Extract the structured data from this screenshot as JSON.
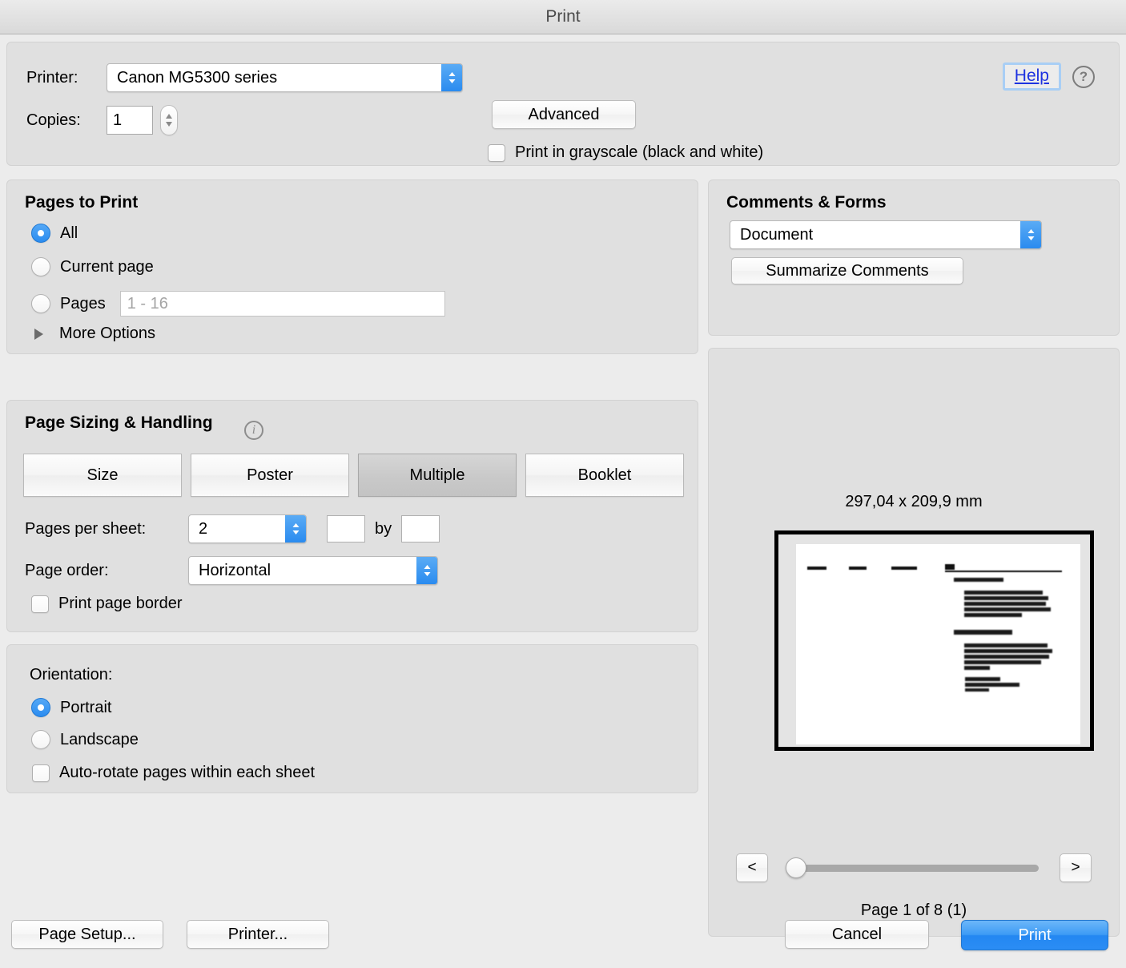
{
  "window": {
    "title": "Print"
  },
  "printer_section": {
    "printer_label": "Printer:",
    "printer_value": "Canon MG5300 series",
    "advanced_label": "Advanced",
    "copies_label": "Copies:",
    "copies_value": "1",
    "grayscale_label": "Print in grayscale (black and white)",
    "grayscale_checked": false,
    "help_label": "Help",
    "help_icon": "question-mark-icon"
  },
  "pages_to_print": {
    "title": "Pages to Print",
    "options": [
      {
        "label": "All",
        "selected": true
      },
      {
        "label": "Current page",
        "selected": false
      },
      {
        "label": "Pages",
        "selected": false
      }
    ],
    "pages_placeholder": "1 - 16",
    "pages_value": "",
    "more_options_label": "More Options",
    "more_options_expanded": false
  },
  "page_sizing": {
    "title": "Page Sizing & Handling",
    "info_icon": "info-icon",
    "segments": [
      {
        "label": "Size",
        "selected": false
      },
      {
        "label": "Poster",
        "selected": false
      },
      {
        "label": "Multiple",
        "selected": true
      },
      {
        "label": "Booklet",
        "selected": false
      }
    ],
    "pages_per_sheet_label": "Pages per sheet:",
    "pages_per_sheet_value": "2",
    "custom_cols_value": "",
    "by_label": "by",
    "custom_rows_value": "",
    "page_order_label": "Page order:",
    "page_order_value": "Horizontal",
    "print_page_border_label": "Print page border",
    "print_page_border_checked": false
  },
  "orientation": {
    "title": "Orientation:",
    "options": [
      {
        "label": "Portrait",
        "selected": true
      },
      {
        "label": "Landscape",
        "selected": false
      }
    ],
    "auto_rotate_label": "Auto-rotate pages within each sheet",
    "auto_rotate_checked": false
  },
  "comments_forms": {
    "title": "Comments & Forms",
    "select_value": "Document",
    "summarize_label": "Summarize Comments"
  },
  "preview": {
    "dimensions": "297,04 x 209,9 mm",
    "prev_label": "<",
    "next_label": ">",
    "page_status": "Page 1 of 8 (1)",
    "slider_position_percent": 0
  },
  "footer": {
    "page_setup_label": "Page Setup...",
    "printer_label": "Printer...",
    "cancel_label": "Cancel",
    "print_label": "Print"
  },
  "colors": {
    "accent_blue": "#2b8cf0",
    "window_bg": "#ececec",
    "panel_bg": "#e0e0e0",
    "help_link": "#1d32e0",
    "print_button": "#2387f2"
  }
}
